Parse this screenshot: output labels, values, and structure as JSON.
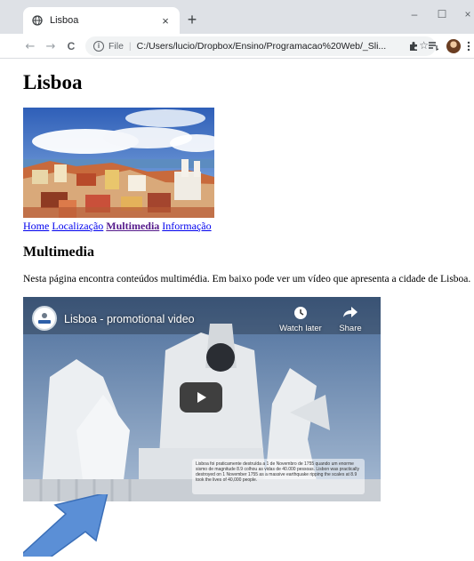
{
  "browser": {
    "tab_title": "Lisboa",
    "tab_close": "×",
    "new_tab": "+",
    "window": {
      "minimize": "–",
      "maximize": "☐",
      "close": "×"
    },
    "nav": {
      "back": "←",
      "forward": "→",
      "reload": "C"
    },
    "address": {
      "scheme_label": "File",
      "separator": "|",
      "url": "C:/Users/lucio/Dropbox/Ensino/Programacao%20Web/_Sli..."
    },
    "icons": [
      "star-icon",
      "extensions-icon",
      "reading-list-icon",
      "profile-avatar",
      "menu-icon"
    ]
  },
  "page": {
    "title": "Lisboa",
    "nav_links": [
      {
        "label": "Home"
      },
      {
        "label": "Localização"
      },
      {
        "label": "Multimedia",
        "current": true
      },
      {
        "label": "Informação"
      }
    ],
    "section_heading": "Multimedia",
    "paragraph": "Nesta página encontra conteúdos multimédia. Em baixo pode ver um vídeo que apresenta a cidade de Lisboa.",
    "video": {
      "title": "Lisboa - promotional video",
      "watch_later": "Watch later",
      "share": "Share",
      "caption": "Lisboa foi praticamente destruída a 1 de Novembro de 1755 quando um enorme sismo de magnitude 8.9 colhou as vidas de 40.000 pessoas. Lisbon was practically destroyed on 1 November 1755 as a massive earthquake ripping the scales at 8.9 took the lives of 40,000 people.",
      "channel_logo": "LUK"
    }
  },
  "colors": {
    "link": "#0000ee",
    "visited_link": "#551a8b",
    "chrome_bg": "#dee1e6",
    "annotation_arrow": "#5b8fd6"
  }
}
